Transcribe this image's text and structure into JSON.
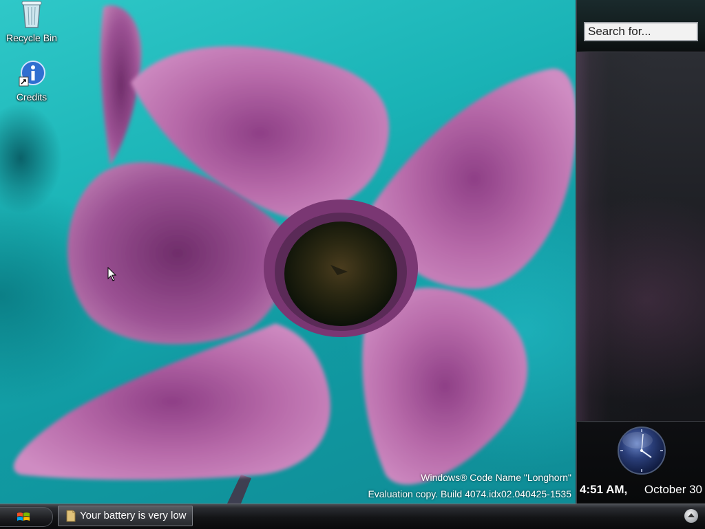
{
  "desktop": {
    "icons": [
      {
        "label": "Recycle Bin",
        "icon": "recycle-bin-icon"
      },
      {
        "label": "Credits",
        "icon": "info-shortcut-icon"
      }
    ],
    "watermark": {
      "line1": "Windows® Code Name \"Longhorn\"",
      "line2": "Evaluation copy. Build 4074.idx02.040425-1535"
    }
  },
  "sidebar": {
    "search_placeholder": "Search for...",
    "clock": {
      "time": "4:51 AM,",
      "date": "October 30"
    }
  },
  "taskbar": {
    "start_icon": "windows-flag-icon",
    "tasks": [
      {
        "label": "Your battery is very low",
        "icon": "battery-folder-icon"
      }
    ],
    "tray_icon": "show-tray-arrow-icon"
  },
  "colors": {
    "wallpaper_teal": "#1ab3b6",
    "petal_pink": "#b46aa6",
    "taskbar_dark": "#131416"
  }
}
